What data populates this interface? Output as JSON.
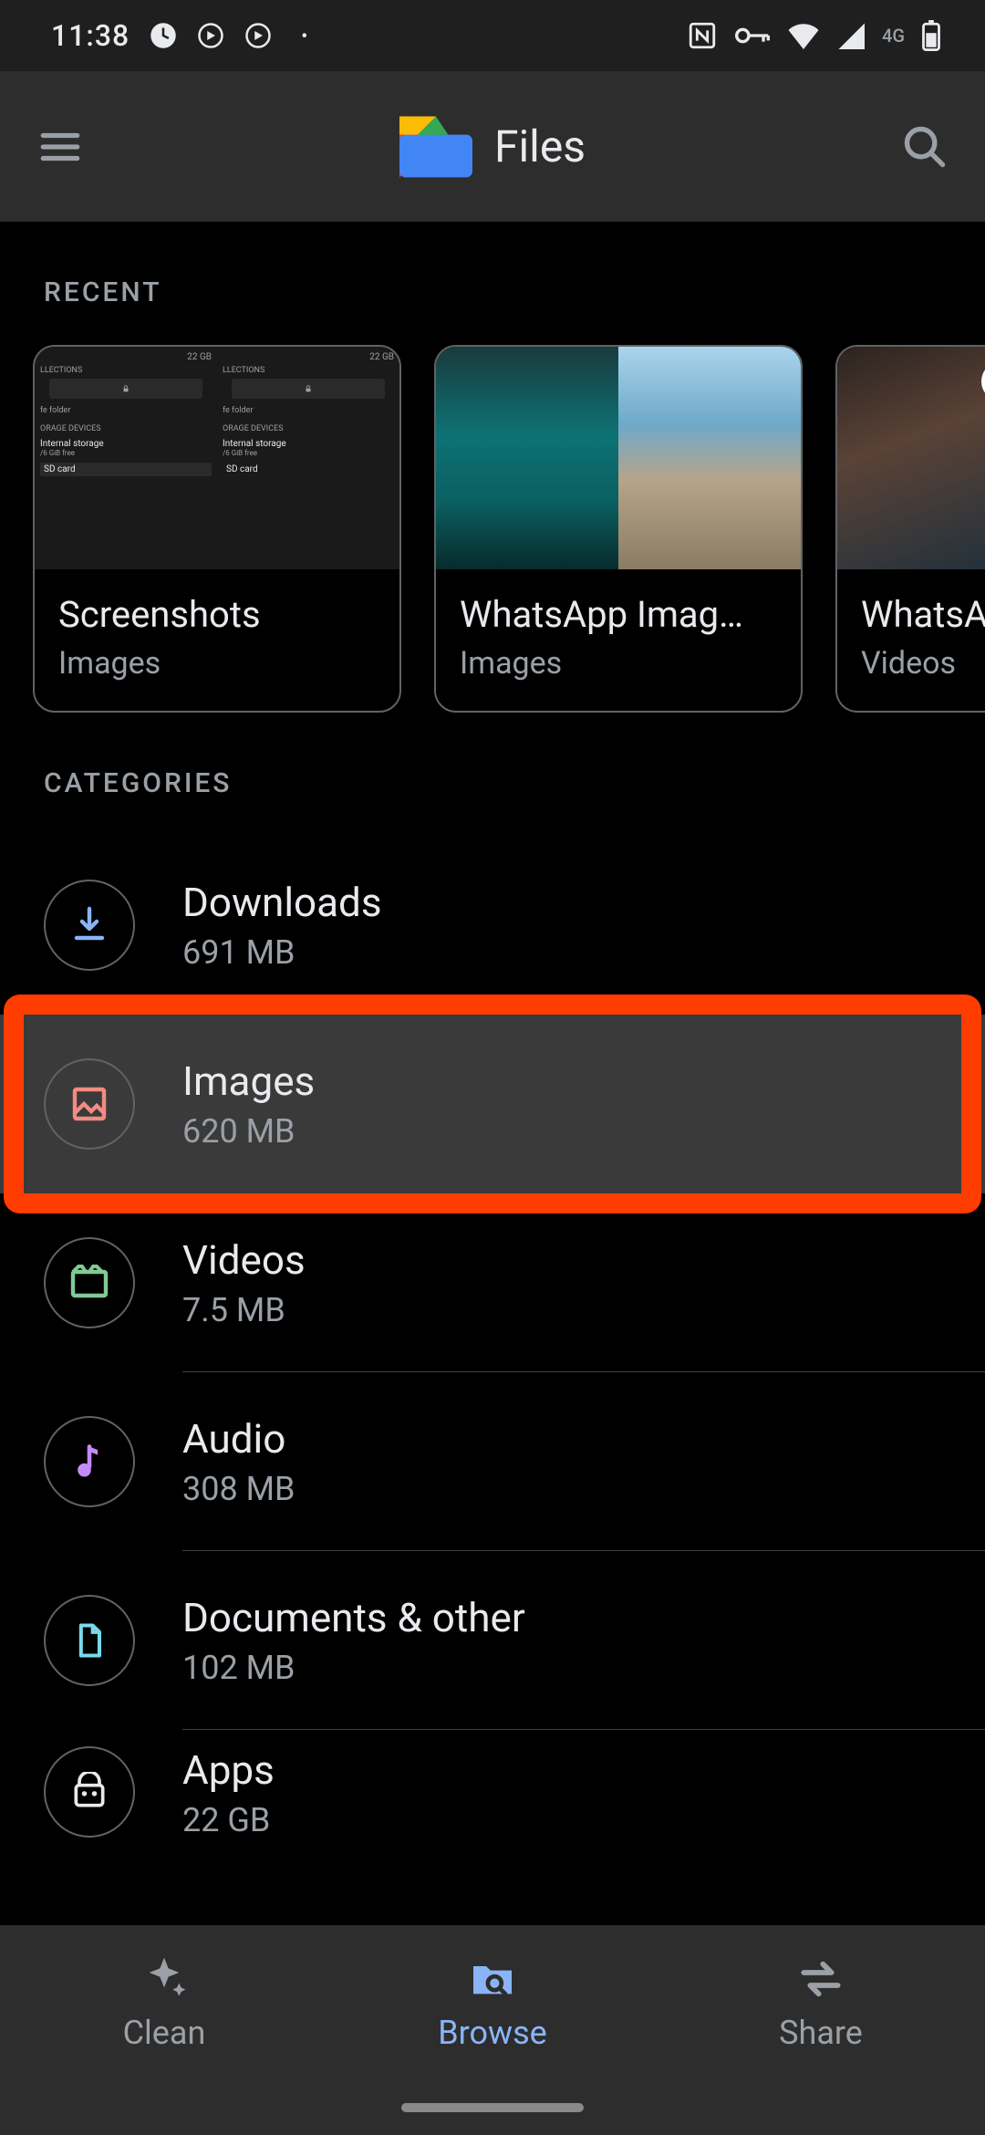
{
  "status": {
    "time": "11:38",
    "network_label": "4G"
  },
  "appbar": {
    "title": "Files"
  },
  "sections": {
    "recent_label": "RECENT",
    "categories_label": "CATEGORIES"
  },
  "recent": [
    {
      "title": "Screenshots",
      "subtitle": "Images"
    },
    {
      "title": "WhatsApp Imag…",
      "subtitle": "Images"
    },
    {
      "title": "WhatsAp",
      "subtitle": "Videos"
    }
  ],
  "categories": [
    {
      "key": "downloads",
      "title": "Downloads",
      "size": "691 MB"
    },
    {
      "key": "images",
      "title": "Images",
      "size": "620 MB"
    },
    {
      "key": "videos",
      "title": "Videos",
      "size": "7.5 MB"
    },
    {
      "key": "audio",
      "title": "Audio",
      "size": "308 MB"
    },
    {
      "key": "documents",
      "title": "Documents & other",
      "size": "102 MB"
    },
    {
      "key": "apps",
      "title": "Apps",
      "size": "22 GB"
    }
  ],
  "highlighted_category_index": 1,
  "nav": {
    "clean": "Clean",
    "browse": "Browse",
    "share": "Share",
    "active": "browse"
  },
  "mini_preview": {
    "header": "22 GB",
    "section1": "LLECTIONS",
    "folder": "fe folder",
    "section2": "ORAGE DEVICES",
    "storage": "Internal storage",
    "storage_sub": "/6 GiB free",
    "sd": "SD card"
  }
}
